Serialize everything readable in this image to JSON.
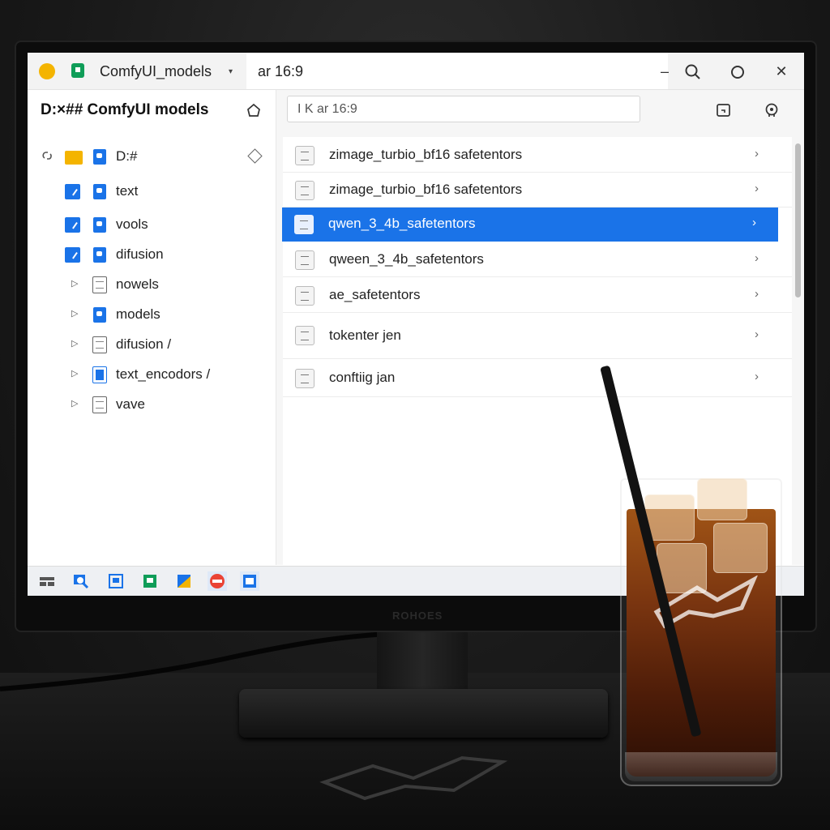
{
  "titlebar": {
    "app_title": "ComfyUI_models",
    "caret": "▾",
    "tab2_title": "ar 16:9",
    "minimize": "–",
    "search": "🔍",
    "maximize": "○",
    "close": "✕"
  },
  "sidebar": {
    "path_title": "D:×## ComfyUI models",
    "root_label": "D:#",
    "items": [
      {
        "label": "text",
        "checked": true
      },
      {
        "label": "vools",
        "checked": true
      },
      {
        "label": "difusion",
        "checked": true
      },
      {
        "label": "nowels",
        "expandable": true
      },
      {
        "label": "models",
        "expandable": true
      },
      {
        "label": "difusion  /",
        "expandable": true
      },
      {
        "label": "text_encodors  /",
        "expandable": true
      },
      {
        "label": "vave",
        "expandable": true
      }
    ]
  },
  "main": {
    "search_value": "I K ar 16:9",
    "files": [
      {
        "name": "zimage_turbio_bf16 safetentors",
        "selected": false
      },
      {
        "name": "zimage_turbio_bf16 safetentors",
        "selected": false
      },
      {
        "name": "qwen_3_4b_safetentors",
        "selected": true
      },
      {
        "name": "qween_3_4b_safetentors",
        "selected": false
      },
      {
        "name": "ae_safetentors",
        "selected": false
      },
      {
        "name": "tokenter jen",
        "selected": false
      },
      {
        "name": "conftiig jan",
        "selected": false
      }
    ],
    "chevron": "›"
  },
  "monitor": {
    "brand": "ROHOES"
  },
  "colors": {
    "accent": "#1a73e8",
    "folder": "#f4b400",
    "app_green": "#0f9d58"
  }
}
